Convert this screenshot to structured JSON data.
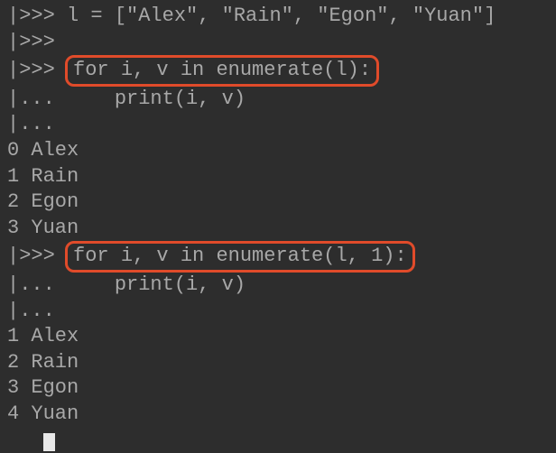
{
  "prompts": {
    "primary": "|>>> ",
    "secondary": "|... "
  },
  "lines": [
    {
      "type": "input",
      "prompt": "primary",
      "text": "l = [\"Alex\", \"Rain\", \"Egon\", \"Yuan\"]"
    },
    {
      "type": "input",
      "prompt": "primary",
      "text": ""
    },
    {
      "type": "input-highlight",
      "prompt": "primary",
      "text": "for i, v in enumerate(l):"
    },
    {
      "type": "input",
      "prompt": "secondary",
      "text": "    print(i, v)"
    },
    {
      "type": "input",
      "prompt": "secondary",
      "text": ""
    },
    {
      "type": "output",
      "text": "0 Alex"
    },
    {
      "type": "output",
      "text": "1 Rain"
    },
    {
      "type": "output",
      "text": "2 Egon"
    },
    {
      "type": "output",
      "text": "3 Yuan"
    },
    {
      "type": "input-highlight",
      "prompt": "primary",
      "text": "for i, v in enumerate(l, 1):"
    },
    {
      "type": "input",
      "prompt": "secondary",
      "text": "    print(i, v)"
    },
    {
      "type": "input",
      "prompt": "secondary",
      "text": ""
    },
    {
      "type": "output",
      "text": "1 Alex"
    },
    {
      "type": "output",
      "text": "2 Rain"
    },
    {
      "type": "output",
      "text": "3 Egon"
    },
    {
      "type": "output-cursor",
      "text": "4 Yuan"
    }
  ]
}
